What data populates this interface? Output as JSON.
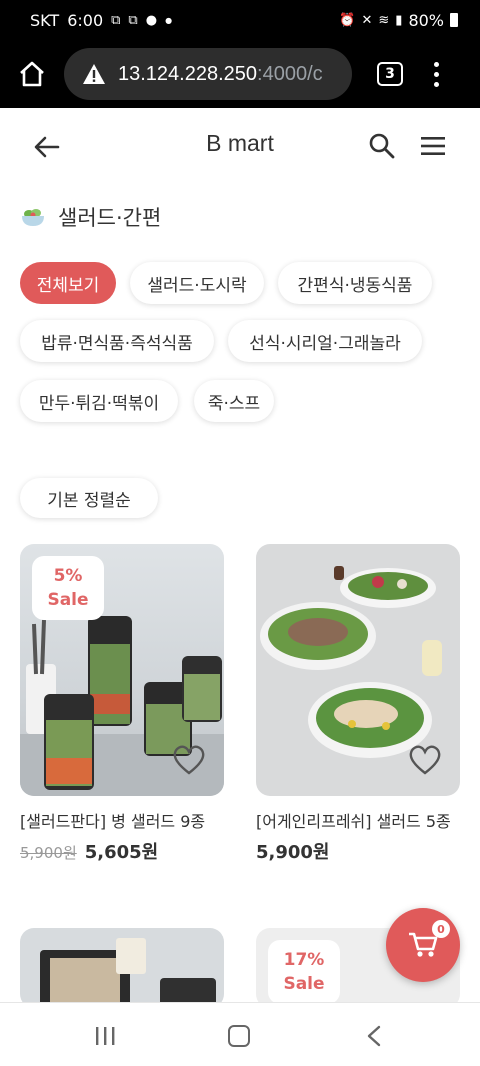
{
  "status_bar": {
    "carrier": "SKT",
    "time": "6:00",
    "battery": "80%"
  },
  "browser": {
    "url_main": "13.124.228.250",
    "url_dim": ":4000/c",
    "tab_count": "3"
  },
  "header": {
    "title": "B mart"
  },
  "category": {
    "title": "샐러드·간편"
  },
  "chips": [
    "전체보기",
    "샐러드·도시락",
    "간편식·냉동식품",
    "밥류·면식품·즉석식품",
    "선식·시리얼·그래놀라",
    "만두·튀김·떡볶이",
    "죽·스프"
  ],
  "sort": {
    "label": "기본 정렬순"
  },
  "products": [
    {
      "badge_pct": "5%",
      "badge_label": "Sale",
      "name": "[샐러드판다] 병 샐러드 9종",
      "old_price": "5,900원",
      "price": "5,605원"
    },
    {
      "name": "[어게인리프레쉬] 샐러드 5종",
      "price": "5,900원"
    },
    {
      "name": ""
    },
    {
      "badge_pct": "17%",
      "badge_label": "Sale",
      "name": ""
    }
  ],
  "cart": {
    "count": "0"
  },
  "colors": {
    "accent": "#e05a5a",
    "badge_text": "#e06666"
  }
}
